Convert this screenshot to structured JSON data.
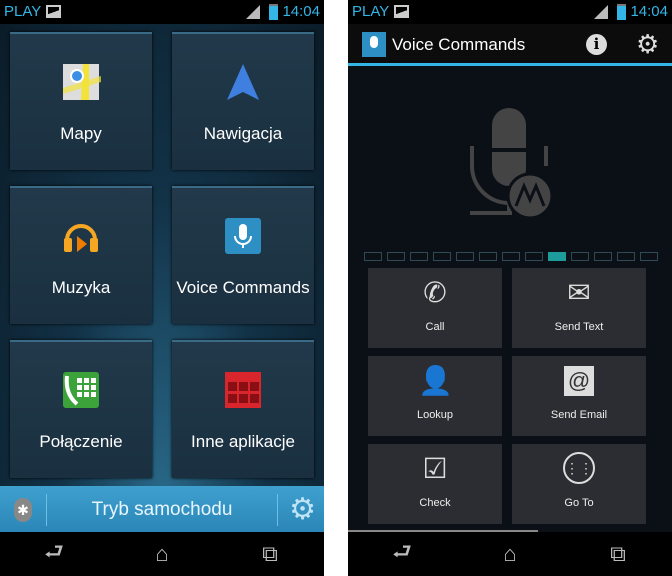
{
  "status": {
    "carrier": "PLAY",
    "time": "14:04"
  },
  "left": {
    "tiles": [
      {
        "label": "Mapy",
        "icon": "maps-icon"
      },
      {
        "label": "Nawigacja",
        "icon": "navigation-icon"
      },
      {
        "label": "Muzyka",
        "icon": "music-icon"
      },
      {
        "label": "Voice Commands",
        "icon": "voice-commands-icon"
      },
      {
        "label": "Połączenie",
        "icon": "phone-dialer-icon"
      },
      {
        "label": "Inne aplikacje",
        "icon": "apps-icon"
      }
    ],
    "car_bar": {
      "title": "Tryb samochodu"
    }
  },
  "right": {
    "app_title": "Voice Commands",
    "pager": {
      "count": 13,
      "active_index": 8,
      "active_color": "#1e9c9c"
    },
    "tiles": [
      {
        "label": "Call",
        "icon": "phone-icon"
      },
      {
        "label": "Send Text",
        "icon": "envelope-icon"
      },
      {
        "label": "Lookup",
        "icon": "person-icon"
      },
      {
        "label": "Send Email",
        "icon": "email-stamp-icon"
      },
      {
        "label": "Check",
        "icon": "checkbox-icon"
      },
      {
        "label": "Go To",
        "icon": "apps-grid-icon"
      }
    ]
  },
  "colors": {
    "accent": "#33b5e5"
  }
}
